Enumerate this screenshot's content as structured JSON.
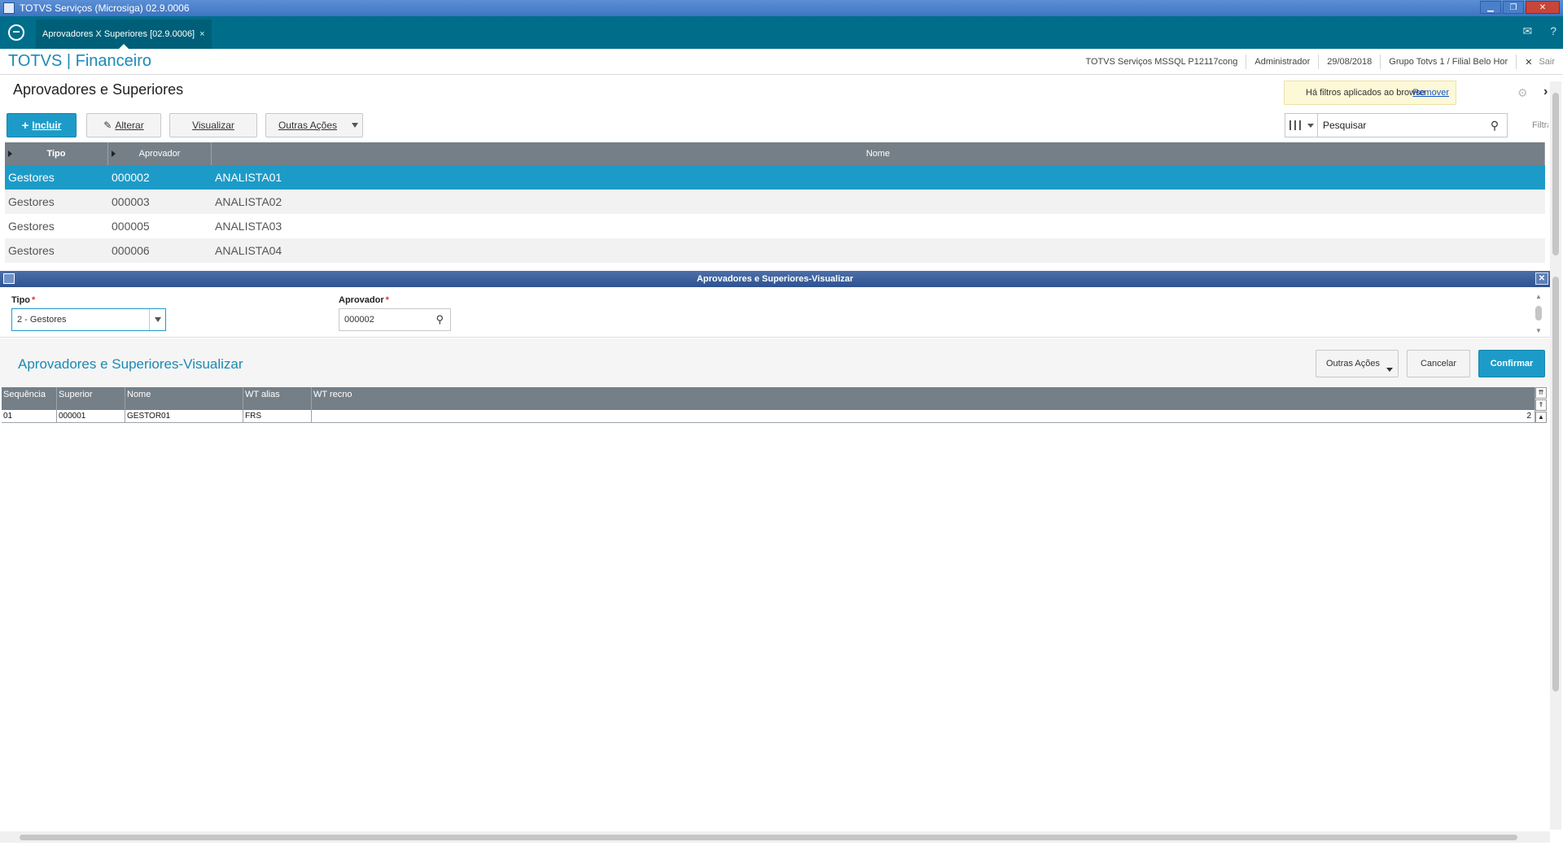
{
  "window": {
    "title": "TOTVS Serviços (Microsiga) 02.9.0006"
  },
  "tabs": [
    {
      "label": "Aprovadores X Superiores [02.9.0006]",
      "close": "×"
    }
  ],
  "header": {
    "brand": "TOTVS | Financeiro",
    "server": "TOTVS Serviços MSSQL P12117cong",
    "user": "Administrador",
    "date": "29/08/2018",
    "company": "Grupo Totvs 1 / Filial Belo Hor",
    "exit": "Sair"
  },
  "page": {
    "title": "Aprovadores e Superiores",
    "filter_notice": "Há filtros aplicados ao browse",
    "filter_remove": "Remover",
    "filter_label": "Filtrar"
  },
  "toolbar": {
    "incluir": "Incluir",
    "alterar": "Alterar",
    "visualizar": "Visualizar",
    "outras_acoes": "Outras Ações",
    "search_placeholder": "Pesquisar"
  },
  "browse": {
    "columns": [
      "Tipo",
      "Aprovador",
      "Nome"
    ],
    "rows": [
      [
        "Gestores",
        "000002",
        "ANALISTA01"
      ],
      [
        "Gestores",
        "000003",
        "ANALISTA02"
      ],
      [
        "Gestores",
        "000005",
        "ANALISTA03"
      ],
      [
        "Gestores",
        "000006",
        "ANALISTA04"
      ]
    ]
  },
  "dialog": {
    "title": "Aprovadores e Superiores-Visualizar",
    "tipo_label": "Tipo",
    "tipo_value": "2 - Gestores",
    "aprovador_label": "Aprovador",
    "aprovador_value": "000002",
    "required_mark": "*",
    "subtitle": "Aprovadores e Superiores-Visualizar",
    "outras_acoes": "Outras Ações",
    "cancelar": "Cancelar",
    "confirmar": "Confirmar"
  },
  "detail": {
    "columns": [
      "Sequência",
      "Superior",
      "Nome",
      "WT alias",
      "WT recno"
    ],
    "rows": [
      [
        "01",
        "000001",
        "GESTOR01",
        "FRS",
        "2"
      ]
    ]
  },
  "colors": {
    "accent": "#1d9bc8",
    "tabbar": "#006e8a",
    "brand": "#1b8ab4",
    "grid_header": "#757f87"
  }
}
